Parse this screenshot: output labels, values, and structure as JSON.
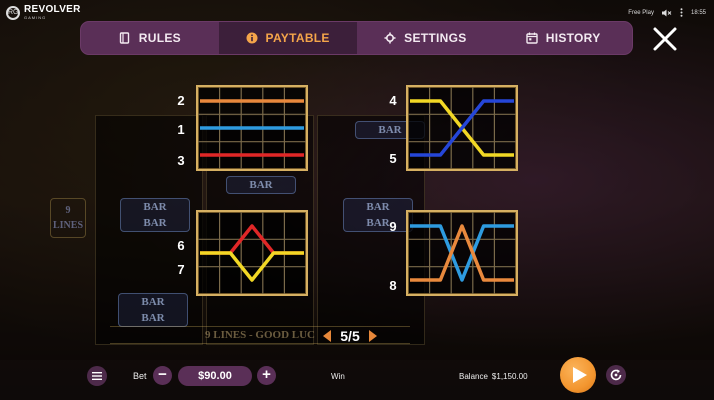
{
  "brand": {
    "name": "REVOLVER",
    "sub": "GAMING",
    "mark": "RG"
  },
  "status": {
    "mode": "Free Play",
    "time": "18:55"
  },
  "tabs": [
    {
      "label": "RULES",
      "icon": "book-icon"
    },
    {
      "label": "PAYTABLE",
      "icon": "info-icon",
      "active": true
    },
    {
      "label": "SETTINGS",
      "icon": "gear-icon"
    },
    {
      "label": "HISTORY",
      "icon": "calendar-icon"
    }
  ],
  "background": {
    "lines_badge": [
      "9",
      "LINES"
    ],
    "goodluck": "9 LINES - GOOD LUC",
    "bar_symbol": "BAR"
  },
  "paylines": {
    "labels": {
      "p1a": "2",
      "p1b": "1",
      "p1c": "3",
      "p2a": "4",
      "p2b": "5",
      "p3a": "6",
      "p3b": "7",
      "p4a": "9",
      "p4b": "8"
    },
    "lines": [
      {
        "number": "1",
        "color": "#2e9be0",
        "rows": [
          1,
          1,
          1,
          1,
          1
        ]
      },
      {
        "number": "2",
        "color": "#e9893d",
        "rows": [
          0,
          0,
          0,
          0,
          0
        ]
      },
      {
        "number": "3",
        "color": "#e02727",
        "rows": [
          2,
          2,
          2,
          2,
          2
        ]
      },
      {
        "number": "4",
        "color": "#f2d825",
        "rows": [
          0,
          0,
          1,
          2,
          2
        ]
      },
      {
        "number": "5",
        "color": "#2546d8",
        "rows": [
          2,
          2,
          1,
          0,
          0
        ]
      },
      {
        "number": "6",
        "color": "#e02727",
        "rows": [
          1,
          1,
          0,
          1,
          1
        ]
      },
      {
        "number": "7",
        "color": "#f2d825",
        "rows": [
          1,
          1,
          2,
          1,
          1
        ]
      },
      {
        "number": "8",
        "color": "#e9893d",
        "rows": [
          2,
          2,
          0,
          2,
          2
        ]
      },
      {
        "number": "9",
        "color": "#2e9be0",
        "rows": [
          0,
          0,
          2,
          0,
          0
        ]
      }
    ]
  },
  "pager": {
    "text": "5/5"
  },
  "bottom": {
    "bet_label": "Bet",
    "bet_value": "$90.00",
    "minus": "−",
    "plus": "+",
    "win_label": "Win",
    "balance_label": "Balance",
    "balance_value": "$1,150.00"
  }
}
